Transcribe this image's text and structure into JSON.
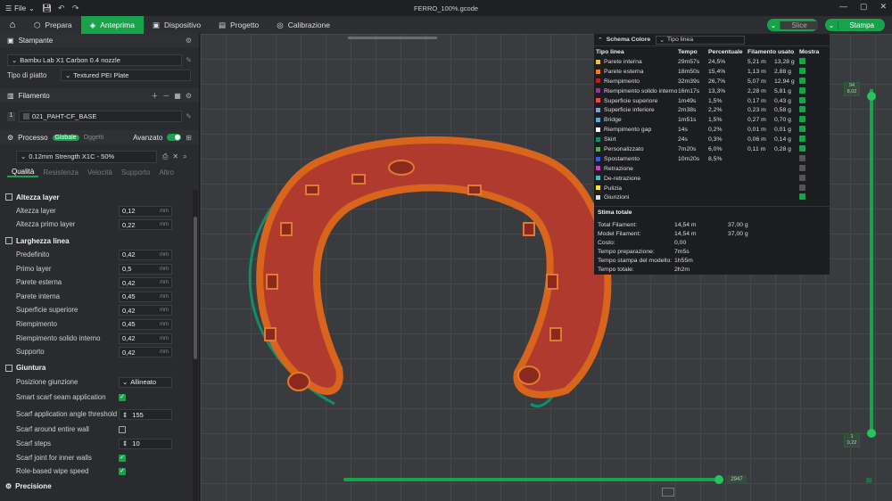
{
  "titlebar": {
    "file_label": "File",
    "title": "FERRO_100%.gcode"
  },
  "nav": {
    "tabs": [
      {
        "label": "Prepara"
      },
      {
        "label": "Anteprima"
      },
      {
        "label": "Dispositivo"
      },
      {
        "label": "Progetto"
      },
      {
        "label": "Calibrazione"
      }
    ],
    "slice_label": "Slice",
    "print_label": "Stampa"
  },
  "sidebar": {
    "printer_title": "Stampante",
    "printer_name": "Bambu Lab X1 Carbon 0.4 nozzle",
    "plate_label": "Tipo di piatto",
    "plate_value": "Textured PEI Plate",
    "filament_title": "Filamento",
    "filament_index": "1",
    "filament_name": "021_PAHT-CF_BASE",
    "process_title": "Processo",
    "process_global": "Globale",
    "process_objects": "Oggetti",
    "advanced_label": "Avanzato",
    "profile": "0.12mm Strength X1C - 50%",
    "subtabs": [
      "Qualità",
      "Resistenza",
      "Velocità",
      "Supporto",
      "Altro"
    ],
    "groups": {
      "layer": "Altezza layer",
      "width": "Larghezza linea",
      "seam": "Giuntura",
      "precision": "Precisione"
    },
    "unit": "mm",
    "layer_rows": [
      {
        "label": "Altezza layer",
        "value": "0,12"
      },
      {
        "label": "Altezza primo layer",
        "value": "0,22"
      }
    ],
    "width_rows": [
      {
        "label": "Predefinito",
        "value": "0,42"
      },
      {
        "label": "Primo layer",
        "value": "0,5"
      },
      {
        "label": "Parete esterna",
        "value": "0,42"
      },
      {
        "label": "Parete interna",
        "value": "0,45"
      },
      {
        "label": "Superficie superiore",
        "value": "0,42"
      },
      {
        "label": "Riempimento",
        "value": "0,45"
      },
      {
        "label": "Riempimento solido interno",
        "value": "0,42"
      },
      {
        "label": "Supporto",
        "value": "0,42"
      }
    ],
    "seam_position_label": "Posizione giunzione",
    "seam_position_value": "Allineato",
    "smart_scarf_label": "Smart scarf seam application",
    "scarf_threshold_label": "Scarf application angle threshold",
    "scarf_threshold_value": "155",
    "scarf_around_label": "Scarf around entire wall",
    "scarf_steps_label": "Scarf steps",
    "scarf_steps_value": "10",
    "scarf_inner_label": "Scarf joint for inner walls",
    "role_wipe_label": "Role-based wipe speed"
  },
  "legend": {
    "title": "Schema Colore",
    "mode": "Tipo linea",
    "headers": [
      "Tipo linea",
      "Tempo",
      "Percentuale",
      "Filamento usato",
      "Mostra"
    ],
    "rows": [
      {
        "name": "Parete interna",
        "color": "#f5c518",
        "time": "29m57s",
        "pct": "24,5%",
        "len": "5,21 m",
        "g": "13,28 g",
        "show": true
      },
      {
        "name": "Parete esterna",
        "color": "#f57c1c",
        "time": "18m50s",
        "pct": "15,4%",
        "len": "1,13 m",
        "g": "2,88 g",
        "show": true
      },
      {
        "name": "Riempimento",
        "color": "#b22222",
        "time": "32m39s",
        "pct": "26,7%",
        "len": "5,07 m",
        "g": "12,94 g",
        "show": true
      },
      {
        "name": "Riempimento solido interno",
        "color": "#9b30a0",
        "time": "16m17s",
        "pct": "13,3%",
        "len": "2,28 m",
        "g": "5,81 g",
        "show": true
      },
      {
        "name": "Superficie superiore",
        "color": "#e84a4a",
        "time": "1m49s",
        "pct": "1,5%",
        "len": "0,17 m",
        "g": "0,43 g",
        "show": true
      },
      {
        "name": "Superficie inferiore",
        "color": "#7aa0e8",
        "time": "2m38s",
        "pct": "2,2%",
        "len": "0,23 m",
        "g": "0,58 g",
        "show": true
      },
      {
        "name": "Bridge",
        "color": "#5fa8d0",
        "time": "1m51s",
        "pct": "1,5%",
        "len": "0,27 m",
        "g": "0,70 g",
        "show": true
      },
      {
        "name": "Riempimento gap",
        "color": "#ffffff",
        "time": "14s",
        "pct": "0,2%",
        "len": "0,01 m",
        "g": "0,01 g",
        "show": true
      },
      {
        "name": "Skirt",
        "color": "#0e8f6a",
        "time": "24s",
        "pct": "0,3%",
        "len": "0,06 m",
        "g": "0,14 g",
        "show": true
      },
      {
        "name": "Personalizzato",
        "color": "#4caf50",
        "time": "7m20s",
        "pct": "6,0%",
        "len": "0,11 m",
        "g": "0,28 g",
        "show": true
      },
      {
        "name": "Spostamento",
        "color": "#3a5ad8",
        "time": "10m20s",
        "pct": "8,5%",
        "len": "",
        "g": "",
        "show": false
      },
      {
        "name": "Retrazione",
        "color": "#c040c0",
        "time": "",
        "pct": "",
        "len": "",
        "g": "",
        "show": false
      },
      {
        "name": "De-retrazione",
        "color": "#2ec0d0",
        "time": "",
        "pct": "",
        "len": "",
        "g": "",
        "show": false
      },
      {
        "name": "Pulizia",
        "color": "#f5e628",
        "time": "",
        "pct": "",
        "len": "",
        "g": "",
        "show": false
      },
      {
        "name": "Giunzioni",
        "color": "#dddddd",
        "time": "",
        "pct": "",
        "len": "",
        "g": "",
        "show": true
      }
    ],
    "estimate_title": "Stima totale",
    "estimates": [
      {
        "k": "Total Filament:",
        "v1": "14,54 m",
        "v2": "37,00 g"
      },
      {
        "k": "Model Filament:",
        "v1": "14,54 m",
        "v2": "37,00 g"
      },
      {
        "k": "Costo:",
        "v1": "0,00",
        "v2": ""
      },
      {
        "k": "Tempo preparazione:",
        "v1": "7m5s",
        "v2": ""
      },
      {
        "k": "Tempo stampa del modello:",
        "v1": "1h55m",
        "v2": ""
      },
      {
        "k": "Tempo totale:",
        "v1": "2h2m",
        "v2": ""
      }
    ]
  },
  "sliders": {
    "top_layer": "94",
    "top_height": "8,02",
    "bottom_layer": "1",
    "bottom_height": "0,22",
    "move_count": "2947"
  },
  "colors": {
    "accent": "#16a34a",
    "model_fill": "#b03a2e",
    "model_edge": "#d9651c"
  }
}
